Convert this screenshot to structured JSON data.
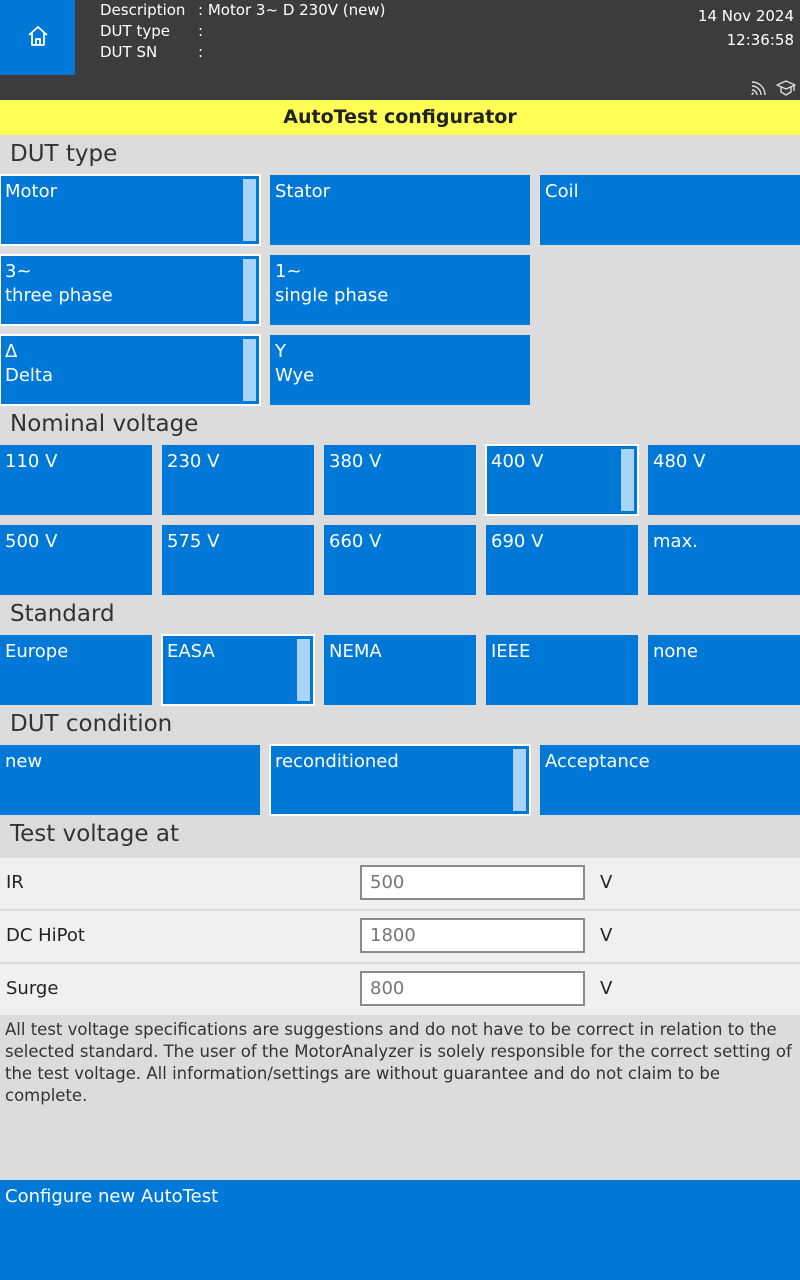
{
  "header": {
    "description_key": "Description",
    "description_value": ": Motor 3~ D 230V (new)",
    "dut_type_key": "DUT type",
    "dut_type_value": ":",
    "dut_sn_key": "DUT SN",
    "dut_sn_value": ":",
    "date": "14 Nov 2024",
    "time": "12:36:58"
  },
  "title": "AutoTest configurator",
  "sections": {
    "dut_type": "DUT type",
    "nominal_voltage": "Nominal voltage",
    "standard": "Standard",
    "dut_condition": "DUT condition",
    "test_voltage": "Test voltage at"
  },
  "dut_type": {
    "motor": "Motor",
    "stator": "Stator",
    "coil": "Coil",
    "three_phase_sym": "3~",
    "three_phase": "three phase",
    "single_phase_sym": "1~",
    "single_phase": "single phase",
    "delta_sym": "Δ",
    "delta": "Delta",
    "wye_sym": "Y",
    "wye": "Wye"
  },
  "voltages": [
    "110 V",
    "230 V",
    "380 V",
    "400 V",
    "480 V",
    "500 V",
    "575 V",
    "660 V",
    "690 V",
    "max."
  ],
  "standards": [
    "Europe",
    "EASA",
    "NEMA",
    "IEEE",
    "none"
  ],
  "conditions": [
    "new",
    "reconditioned",
    "Acceptance"
  ],
  "test_voltage": {
    "ir_label": "IR",
    "ir_value": "500",
    "hipot_label": "DC HiPot",
    "hipot_value": "1800",
    "surge_label": "Surge",
    "surge_value": "800",
    "unit": "V"
  },
  "note": "All test voltage specifications are suggestions and do not have to be correct in relation to the selected standard. The user of the MotorAnalyzer is solely responsible for the correct setting of the test voltage. All information/settings are without guarantee and do not claim to be complete.",
  "bottom_button": "Configure new AutoTest",
  "colors": {
    "accent": "#0078d7",
    "title_bar": "#ffff55",
    "header_bg": "#3c3c3c",
    "indicator": "#a7d4f7"
  }
}
